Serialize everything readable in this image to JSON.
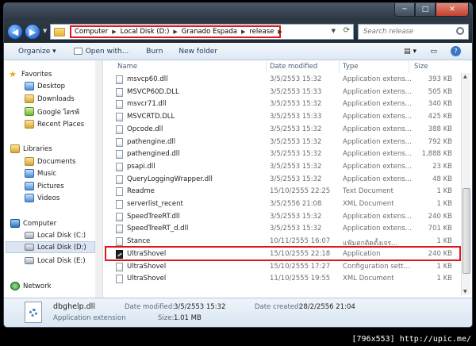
{
  "window": {
    "controls": {
      "minimize": "─",
      "maximize": "□",
      "close": "✕"
    }
  },
  "address": {
    "crumbs": [
      "Computer",
      "Local Disk (D:)",
      "Granado Espada",
      "release"
    ],
    "search_placeholder": "Search release"
  },
  "toolbar": {
    "organize": "Organize ▾",
    "open_with": "Open with...",
    "burn": "Burn",
    "new_folder": "New folder"
  },
  "nav": {
    "favorites": "Favorites",
    "desktop": "Desktop",
    "downloads": "Downloads",
    "google": "Google ไดรฟ์",
    "recent": "Recent Places",
    "libraries": "Libraries",
    "documents": "Documents",
    "music": "Music",
    "pictures": "Pictures",
    "videos": "Videos",
    "computer": "Computer",
    "drive_c": "Local Disk (C:)",
    "drive_d": "Local Disk (D:)",
    "drive_e": "Local Disk (E:)",
    "network": "Network"
  },
  "columns": {
    "name": "Name",
    "date": "Date modified",
    "type": "Type",
    "size": "Size"
  },
  "files": [
    {
      "name": "msvcp60.dll",
      "date": "3/5/2553 15:32",
      "type": "Application extens...",
      "size": "393 KB",
      "icon": "dll"
    },
    {
      "name": "MSVCP60D.DLL",
      "date": "3/5/2553 15:33",
      "type": "Application extens...",
      "size": "505 KB",
      "icon": "dll"
    },
    {
      "name": "msvcr71.dll",
      "date": "3/5/2553 15:32",
      "type": "Application extens...",
      "size": "340 KB",
      "icon": "dll"
    },
    {
      "name": "MSVCRTD.DLL",
      "date": "3/5/2553 15:33",
      "type": "Application extens...",
      "size": "425 KB",
      "icon": "dll"
    },
    {
      "name": "Opcode.dll",
      "date": "3/5/2553 15:32",
      "type": "Application extens...",
      "size": "388 KB",
      "icon": "dll"
    },
    {
      "name": "pathengine.dll",
      "date": "3/5/2553 15:32",
      "type": "Application extens...",
      "size": "792 KB",
      "icon": "dll"
    },
    {
      "name": "pathengined.dll",
      "date": "3/5/2553 15:32",
      "type": "Application extens...",
      "size": "1,888 KB",
      "icon": "dll"
    },
    {
      "name": "psapi.dll",
      "date": "3/5/2553 15:32",
      "type": "Application extens...",
      "size": "23 KB",
      "icon": "dll"
    },
    {
      "name": "QueryLoggingWrapper.dll",
      "date": "3/5/2553 15:32",
      "type": "Application extens...",
      "size": "48 KB",
      "icon": "dll"
    },
    {
      "name": "Readme",
      "date": "15/10/2555 22:25",
      "type": "Text Document",
      "size": "1 KB",
      "icon": "txt"
    },
    {
      "name": "serverlist_recent",
      "date": "3/5/2556 21:08",
      "type": "XML Document",
      "size": "1 KB",
      "icon": "txt"
    },
    {
      "name": "SpeedTreeRT.dll",
      "date": "3/5/2553 15:32",
      "type": "Application extens...",
      "size": "240 KB",
      "icon": "dll"
    },
    {
      "name": "SpeedTreeRT_d.dll",
      "date": "3/5/2553 15:32",
      "type": "Application extens...",
      "size": "701 KB",
      "icon": "dll"
    },
    {
      "name": "Stance",
      "date": "10/11/2555 16:07",
      "type": "แฟ้มตกติดตั้งเจร...",
      "size": "1 KB",
      "icon": "cfg"
    },
    {
      "name": "UltraShovel",
      "date": "15/10/2555 22:18",
      "type": "Application",
      "size": "240 KB",
      "icon": "app"
    },
    {
      "name": "UltraShovel",
      "date": "15/10/2555 17:27",
      "type": "Configuration sett...",
      "size": "1 KB",
      "icon": "cfg"
    },
    {
      "name": "UltraShovel",
      "date": "11/10/2555 19:55",
      "type": "XML Document",
      "size": "1 KB",
      "icon": "txt"
    }
  ],
  "details": {
    "filename": "dbghelp.dll",
    "filetype": "Application extension",
    "modified_label": "Date modified:",
    "modified_value": "3/5/2553 15:32",
    "created_label": "Date created:",
    "created_value": "28/2/2556 21:04",
    "size_label": "Size:",
    "size_value": "1.01 MB"
  },
  "watermark": "[796x553] http://upic.me/"
}
